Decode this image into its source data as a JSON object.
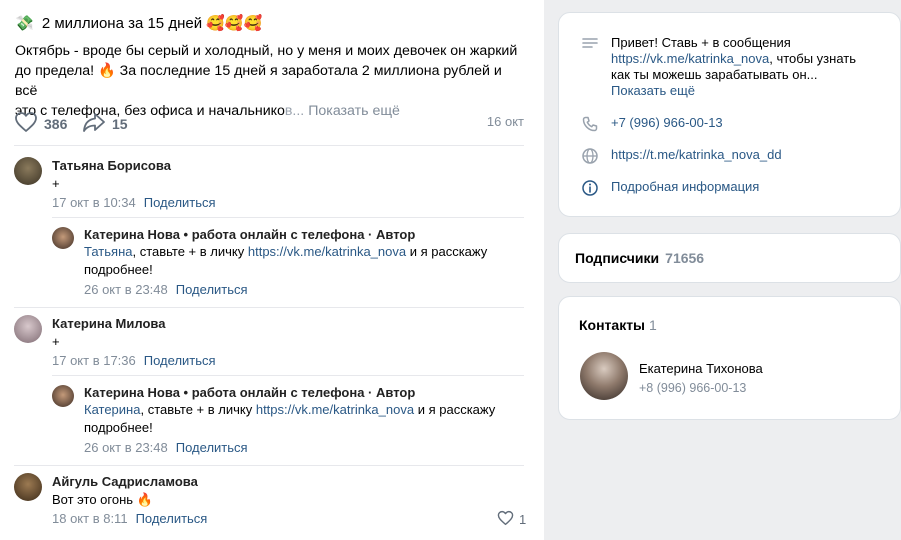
{
  "post": {
    "title_emoji_left": "💸",
    "title": "2 миллиона за 15 дней",
    "title_emoji_right": "🥰🥰🥰",
    "text_line1": "Октябрь - вроде бы серый и холодный, но у меня и моих девочек он жаркий",
    "text_line2_a": "до предела! ",
    "text_line2_emoji": "🔥",
    "text_line2_b": " За последние 15 дней я заработала 2 миллиона рублей и всё",
    "text_line3": "это с телефона, без офиса и начальнико",
    "text_fade": "в...",
    "show_more": "Показать ещё",
    "likes": "386",
    "shares": "15",
    "date": "16 окт"
  },
  "comments": [
    {
      "name": "Татьяна Борисова",
      "text": "+",
      "date": "17 окт в 10:34",
      "share": "Поделиться"
    },
    {
      "name": "Катерина Нова • работа онлайн с телефона · Автор",
      "mention": "Татьяна",
      "text_a": ", ставьте + в личку ",
      "link": "https://vk.me/katrinka_nova",
      "text_b": " и я расскажу",
      "text_c": "подробнее!",
      "date": "26 окт в 23:48",
      "share": "Поделиться"
    },
    {
      "name": "Катерина Милова",
      "text": "+",
      "date": "17 окт в 17:36",
      "share": "Поделиться"
    },
    {
      "name": "Катерина Нова • работа онлайн с телефона · Автор",
      "mention": "Катерина",
      "text_a": ", ставьте + в личку ",
      "link": "https://vk.me/katrinka_nova",
      "text_b": " и я расскажу",
      "text_c": "подробнее!",
      "date": "26 окт в 23:48",
      "share": "Поделиться"
    },
    {
      "name": "Айгуль Садрисламова",
      "text": "Вот это огонь ",
      "emoji": "🔥",
      "date": "18 окт в 8:11",
      "share": "Поделиться",
      "likes": "1"
    }
  ],
  "sidebar": {
    "info": {
      "status_line1": "Привет! Ставь + в сообщения",
      "status_link": "https://vk.me/katrinka_nova",
      "status_line2_rest": ", чтобы узнать",
      "status_line3": "как ты можешь зарабатывать он...",
      "status_more": "Показать ещё",
      "phone": "+7 (996) 966-00-13",
      "site": "https://t.me/katrinka_nova_dd",
      "details": "Подробная информация"
    },
    "subscribers": {
      "label": "Подписчики",
      "count": "71656"
    },
    "contacts": {
      "title": "Контакты",
      "count": "1",
      "name": "Екатерина Тихонова",
      "phone": "+8 (996) 966-00-13"
    }
  }
}
